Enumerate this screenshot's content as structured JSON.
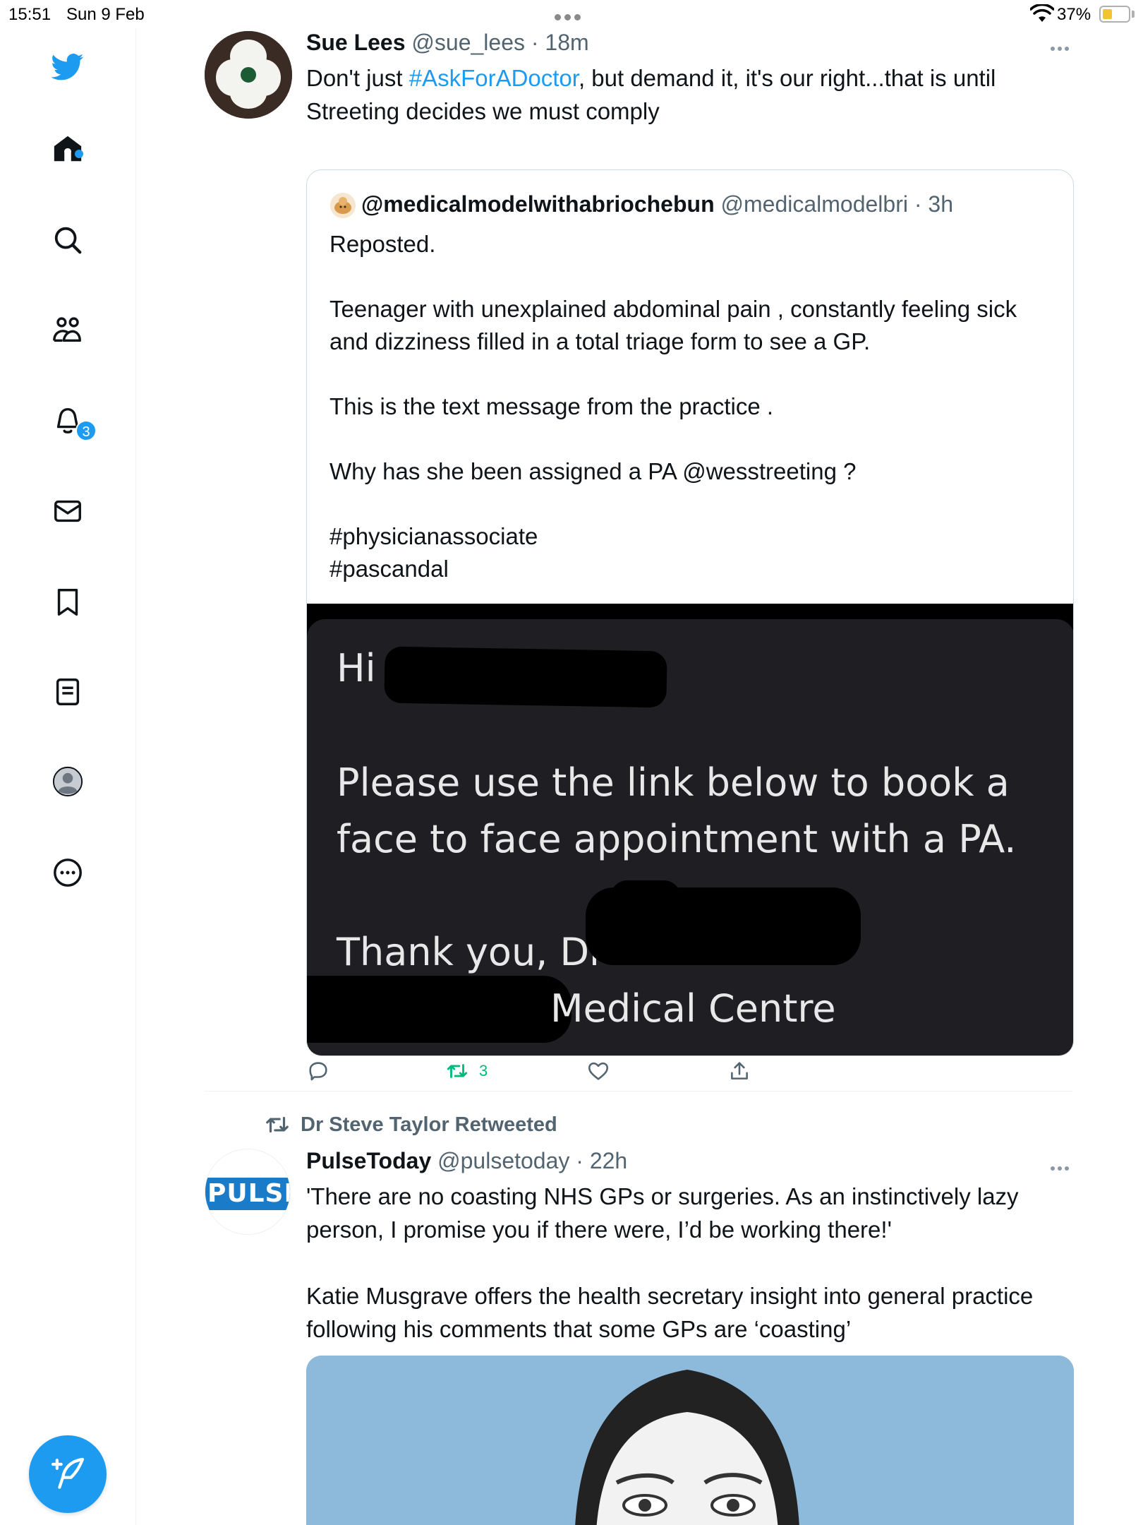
{
  "status_bar": {
    "time": "15:51",
    "date": "Sun 9 Feb",
    "battery": "37%",
    "battery_level_percent": 37
  },
  "sidebar": {
    "items": [
      {
        "name": "home-icon",
        "label": "Home"
      },
      {
        "name": "search-icon",
        "label": "Explore"
      },
      {
        "name": "communities-icon",
        "label": "Communities"
      },
      {
        "name": "bell-icon",
        "label": "Notifications"
      },
      {
        "name": "mail-icon",
        "label": "Messages"
      },
      {
        "name": "bookmark-icon",
        "label": "Bookmarks"
      },
      {
        "name": "lists-icon",
        "label": "Lists"
      },
      {
        "name": "profile-icon",
        "label": "Profile"
      },
      {
        "name": "more-icon",
        "label": "More"
      }
    ],
    "notifications_badge": "3",
    "compose_icon": "compose-icon"
  },
  "tweet1": {
    "author_name": "Sue Lees",
    "handle": "@sue_lees",
    "time": "18m",
    "text_prefix": "Don't just ",
    "hashtag": "#AskForADoctor",
    "text_suffix": ", but demand it, it's our right...that is until\nStreeting decides we must comply",
    "quote": {
      "author_name": "@medicalmodelwithabriochebun",
      "handle": "@medicalmodelbri",
      "time": "3h",
      "text": "Reposted.\n\nTeenager with unexplained abdominal pain , constantly feeling sick\nand dizziness filled in a total triage form to see a GP.\n\nThis is the text message from the practice .\n\nWhy has she been assigned a PA @wesstreeting ?\n\n#physicianassociate\n#pascandal",
      "media": {
        "line1": "Hi",
        "line2": "Please use the link below to book a",
        "line3": "face to face appointment with a PA.",
        "line4": "Thank you, Dr",
        "line5": "Medical Centre"
      }
    },
    "actions": {
      "reply": "",
      "retweets": "3",
      "likes": "",
      "share": ""
    }
  },
  "tweet2": {
    "retweeted_by": "Dr Steve Taylor Retweeted",
    "author_name": "PulseToday",
    "handle": "@pulsetoday",
    "time": "22h",
    "avatar_logo": "PULSE",
    "text": "'There are no coasting NHS GPs or surgeries. As an instinctively lazy\nperson, I promise you if there were, I’d be working there!'\n\nKatie Musgrave offers the health secretary insight into general practice\nfollowing his comments that some GPs are ‘coasting’"
  },
  "colors": {
    "accent": "#1d9bf0",
    "retweet_green": "#00ba7c",
    "secondary_text": "#536471"
  }
}
